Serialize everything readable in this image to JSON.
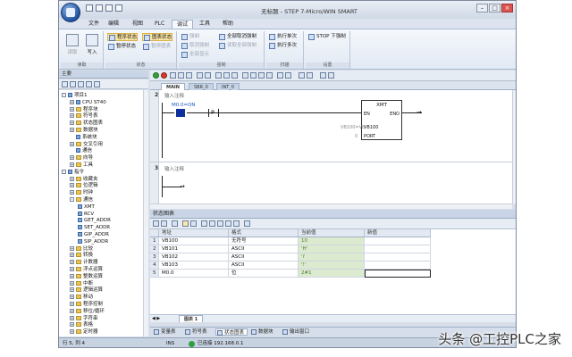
{
  "window": {
    "title": "无标题 - STEP 7-Micro/WIN SMART",
    "minimize": "–",
    "maximize": "□",
    "close": "×"
  },
  "menu": [
    "文件",
    "编辑",
    "视图",
    "PLC",
    "调试",
    "工具",
    "帮助"
  ],
  "menu_active_index": 4,
  "ribbon": {
    "groups": [
      {
        "label": "读取",
        "items": [
          "读取",
          "写入"
        ]
      },
      {
        "label": "状态",
        "items": [
          "程序状态",
          "图表状态",
          "暂停状态",
          "暂停图表"
        ]
      },
      {
        "label": "强制",
        "items": [
          "强制",
          "取消强制",
          "全部显示",
          "全部取消强制",
          "读取全部强制"
        ]
      },
      {
        "label": "扫描",
        "items": [
          "执行单次",
          "执行多次"
        ]
      },
      {
        "label": "设置",
        "items": [
          "STOP 下强制"
        ]
      }
    ]
  },
  "project_panel": {
    "title": "主要"
  },
  "tree": [
    {
      "label": "项目1",
      "level": 0,
      "kind": "root"
    },
    {
      "label": "CPU ST40",
      "level": 1,
      "kind": "device"
    },
    {
      "label": "程序块",
      "level": 1,
      "kind": "folder"
    },
    {
      "label": "符号表",
      "level": 1,
      "kind": "folder"
    },
    {
      "label": "状态图表",
      "level": 1,
      "kind": "folder"
    },
    {
      "label": "数据块",
      "level": 1,
      "kind": "folder"
    },
    {
      "label": "系统块",
      "level": 1,
      "kind": "item"
    },
    {
      "label": "交叉引用",
      "level": 1,
      "kind": "folder"
    },
    {
      "label": "通信",
      "level": 1,
      "kind": "item"
    },
    {
      "label": "向导",
      "level": 1,
      "kind": "folder"
    },
    {
      "label": "工具",
      "level": 1,
      "kind": "folder"
    },
    {
      "label": "指令",
      "level": 0,
      "kind": "root"
    },
    {
      "label": "收藏夹",
      "level": 1,
      "kind": "folder"
    },
    {
      "label": "位逻辑",
      "level": 1,
      "kind": "folder"
    },
    {
      "label": "时钟",
      "level": 1,
      "kind": "folder"
    },
    {
      "label": "通信",
      "level": 1,
      "kind": "folder"
    },
    {
      "label": "XMT",
      "level": 2,
      "kind": "item"
    },
    {
      "label": "RCV",
      "level": 2,
      "kind": "item"
    },
    {
      "label": "GET_ADDR",
      "level": 2,
      "kind": "item"
    },
    {
      "label": "SET_ADDR",
      "level": 2,
      "kind": "item"
    },
    {
      "label": "GIP_ADDR",
      "level": 2,
      "kind": "item"
    },
    {
      "label": "SIP_ADDR",
      "level": 2,
      "kind": "item"
    },
    {
      "label": "比较",
      "level": 1,
      "kind": "folder"
    },
    {
      "label": "转换",
      "level": 1,
      "kind": "folder"
    },
    {
      "label": "计数器",
      "level": 1,
      "kind": "folder"
    },
    {
      "label": "浮点运算",
      "level": 1,
      "kind": "folder"
    },
    {
      "label": "整数运算",
      "level": 1,
      "kind": "folder"
    },
    {
      "label": "中断",
      "level": 1,
      "kind": "folder"
    },
    {
      "label": "逻辑运算",
      "level": 1,
      "kind": "folder"
    },
    {
      "label": "移动",
      "level": 1,
      "kind": "folder"
    },
    {
      "label": "程序控制",
      "level": 1,
      "kind": "folder"
    },
    {
      "label": "移位/循环",
      "level": 1,
      "kind": "folder"
    },
    {
      "label": "字符串",
      "level": 1,
      "kind": "folder"
    },
    {
      "label": "表格",
      "level": 1,
      "kind": "folder"
    },
    {
      "label": "定时器",
      "level": 1,
      "kind": "folder"
    }
  ],
  "editor_tabs": [
    "MAIN",
    "SBR_0",
    "INT_0"
  ],
  "networks": [
    {
      "number": "2",
      "comment": "输入注释",
      "contact": "M0.0=ON",
      "coil": "P",
      "box_name": "XMT",
      "box_en": "EN",
      "box_eno": "ENO",
      "tbl_param": "VB100",
      "tbl_value": "VB100=VB",
      "port_param": "PORT",
      "port_value": "0"
    },
    {
      "number": "3",
      "comment": "输入注释"
    }
  ],
  "status_chart": {
    "title": "状态图表",
    "columns": [
      "地址",
      "格式",
      "当前值",
      "新值"
    ],
    "rows": [
      {
        "n": "1",
        "address": "VB100",
        "format": "无符号",
        "current": "10",
        "new": ""
      },
      {
        "n": "2",
        "address": "VB101",
        "format": "ASCII",
        "current": "'H'",
        "new": ""
      },
      {
        "n": "3",
        "address": "VB102",
        "format": "ASCII",
        "current": "'i'",
        "new": ""
      },
      {
        "n": "4",
        "address": "VB103",
        "format": "ASCII",
        "current": "'!'",
        "new": ""
      },
      {
        "n": "5",
        "address": "M0.0",
        "format": "位",
        "current": "2#1",
        "new": ""
      }
    ],
    "sheet_tab": "图表 1"
  },
  "bottom_tabs": [
    "变量表",
    "符号表",
    "状态图表",
    "数据块",
    "输出窗口"
  ],
  "bottom_tab_selected": 2,
  "status": {
    "position": "行 5, 列 4",
    "ins": "INS",
    "connection": "已连接 192.168.0.1"
  },
  "watermark": "头条 @工控PLC之家"
}
